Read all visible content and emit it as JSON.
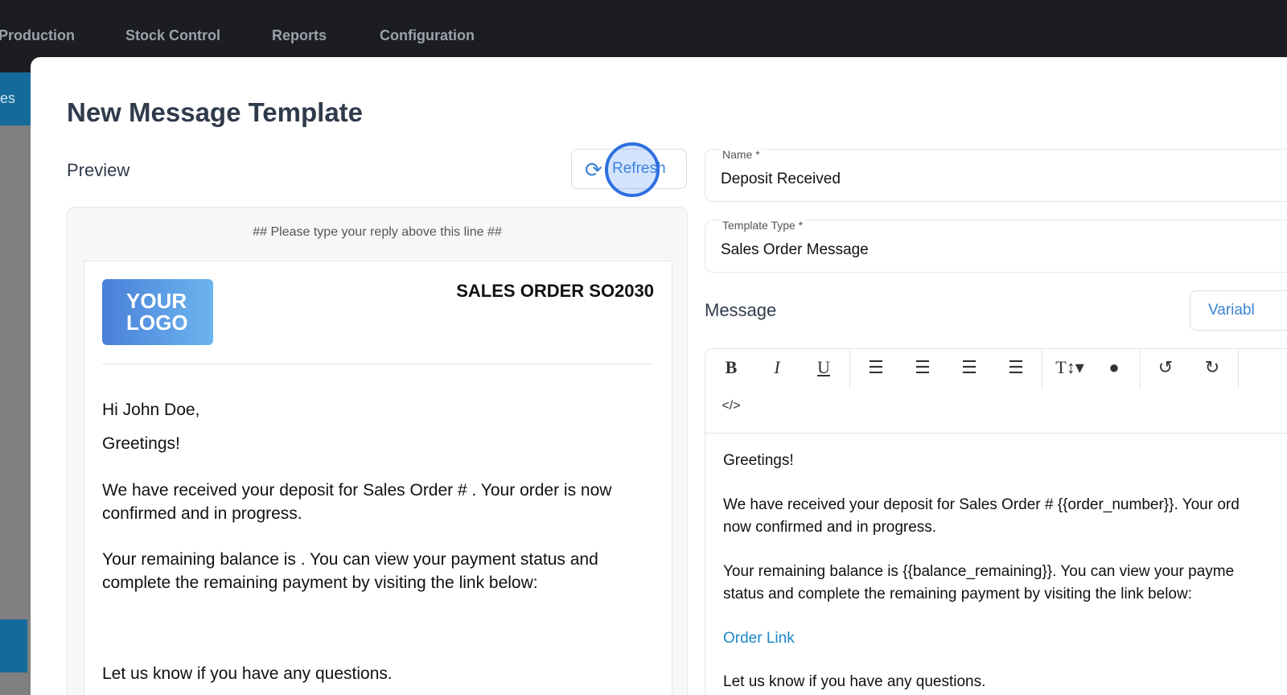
{
  "nav": {
    "items": [
      "Production",
      "Stock Control",
      "Reports",
      "Configuration"
    ],
    "side_tab": "es"
  },
  "modal": {
    "title": "New Message Template"
  },
  "preview": {
    "label": "Preview",
    "refresh_label": "Refresh",
    "reply_line": "## Please type your reply above this line ##",
    "logo_line1": "YOUR",
    "logo_line2": "LOGO",
    "order_title": "SALES ORDER SO2030",
    "greeting": "Hi John Doe,",
    "line1": "Greetings!",
    "para1": "We have received your deposit for Sales Order # . Your order is now confirmed and in progress.",
    "para2": "Your remaining balance is . You can view your payment status and complete the remaining payment by visiting the link below:",
    "closing": "Let us know if you have any questions."
  },
  "form": {
    "name_label": "Name *",
    "name_value": "Deposit Received",
    "type_label": "Template Type *",
    "type_value": "Sales Order Message",
    "message_label": "Message",
    "variables_label": "Variabl"
  },
  "editor": {
    "toolbar": [
      "bold-icon",
      "italic-icon",
      "underline-icon",
      "ordered-list-icon",
      "unordered-list-icon",
      "outdent-icon",
      "indent-icon",
      "font-size-icon",
      "color-icon",
      "undo-icon",
      "redo-icon",
      "code-view-icon"
    ],
    "line1": "Greetings!",
    "p1a": "We have received your deposit for Sales Order # {{order_number}}. Your ord",
    "p1b": "now confirmed and in progress.",
    "p2a": "Your remaining balance is {{balance_remaining}}. You can view your payme",
    "p2b": "status and complete the remaining payment by visiting the link below:",
    "link": "Order Link",
    "closing": "Let us know if you have any questions."
  },
  "colors": {
    "accent": "#3b82d6",
    "nav_bg": "#1b1d22",
    "link": "#1e88c9"
  }
}
